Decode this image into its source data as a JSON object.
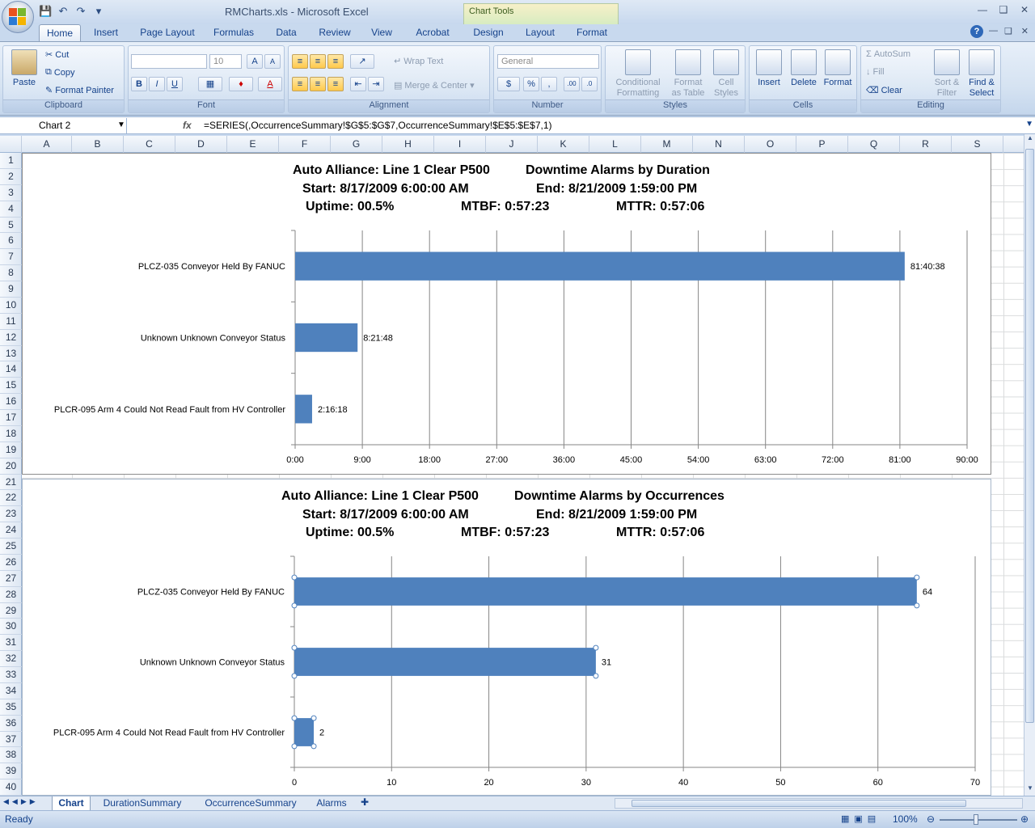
{
  "window": {
    "title": "RMCharts.xls - Microsoft Excel",
    "context_tab_group": "Chart Tools"
  },
  "ribbon_tabs": [
    "Home",
    "Insert",
    "Page Layout",
    "Formulas",
    "Data",
    "Review",
    "View",
    "Acrobat",
    "Design",
    "Layout",
    "Format"
  ],
  "active_tab": "Home",
  "ribbon": {
    "clipboard": {
      "label": "Clipboard",
      "paste": "Paste",
      "cut": "Cut",
      "copy": "Copy",
      "format_painter": "Format Painter"
    },
    "font": {
      "label": "Font",
      "size": "10",
      "bold": "B",
      "italic": "I",
      "underline": "U"
    },
    "alignment": {
      "label": "Alignment",
      "wrap": "Wrap Text",
      "merge": "Merge & Center"
    },
    "number": {
      "label": "Number",
      "format": "General",
      "currency": "$",
      "percent": "%",
      "comma": ","
    },
    "styles": {
      "label": "Styles",
      "cond_l1": "Conditional",
      "cond_l2": "Formatting",
      "fmt_l1": "Format",
      "fmt_l2": "as Table",
      "cell_l1": "Cell",
      "cell_l2": "Styles"
    },
    "cells": {
      "label": "Cells",
      "insert": "Insert",
      "delete": "Delete",
      "format": "Format"
    },
    "editing": {
      "label": "Editing",
      "autosum": "AutoSum",
      "fill": "Fill",
      "clear": "Clear",
      "sort_l1": "Sort &",
      "sort_l2": "Filter",
      "find_l1": "Find &",
      "find_l2": "Select"
    }
  },
  "formula_bar": {
    "name_box": "Chart 2",
    "fx": "fx",
    "formula": "=SERIES(,OccurrenceSummary!$G$5:$G$7,OccurrenceSummary!$E$5:$E$7,1)"
  },
  "columns": [
    "A",
    "B",
    "C",
    "D",
    "E",
    "F",
    "G",
    "H",
    "I",
    "J",
    "K",
    "L",
    "M",
    "N",
    "O",
    "P",
    "Q",
    "R",
    "S"
  ],
  "rows": [
    "1",
    "2",
    "3",
    "4",
    "5",
    "6",
    "7",
    "8",
    "9",
    "10",
    "11",
    "12",
    "13",
    "14",
    "15",
    "16",
    "17",
    "18",
    "19",
    "20",
    "21",
    "22",
    "23",
    "24",
    "25",
    "26",
    "27",
    "28",
    "29",
    "30",
    "31",
    "32",
    "33",
    "34",
    "35",
    "36",
    "37",
    "38",
    "39",
    "40"
  ],
  "sheet_tabs": [
    "Chart",
    "DurationSummary",
    "OccurrenceSummary",
    "Alarms"
  ],
  "active_sheet": "Chart",
  "status": {
    "ready": "Ready",
    "zoom": "100%"
  },
  "chart_data": [
    {
      "type": "bar",
      "title_lines": [
        [
          "Auto Alliance: Line 1 Clear P500",
          "Downtime Alarms by  Duration"
        ],
        [
          "Start: 8/17/2009 6:00:00 AM",
          "End: 8/21/2009 1:59:00 PM"
        ],
        [
          "Uptime: 00.5%",
          "MTBF: 0:57:23",
          "MTTR: 0:57:06"
        ]
      ],
      "categories": [
        "PLCZ-035 Conveyor Held By FANUC",
        "Unknown Unknown Conveyor Status",
        "PLCR-095 Arm 4 Could Not Read Fault from HV Controller"
      ],
      "values_hours": [
        81.6439,
        8.3633,
        2.2717
      ],
      "data_labels": [
        "81:40:38",
        "8:21:48",
        "2:16:18"
      ],
      "xlim": [
        0,
        90
      ],
      "tick_labels": [
        "0:00",
        "9:00",
        "18:00",
        "27:00",
        "36:00",
        "45:00",
        "54:00",
        "63:00",
        "72:00",
        "81:00",
        "90:00"
      ],
      "grid": true
    },
    {
      "type": "bar",
      "title_lines": [
        [
          "Auto Alliance: Line 1 Clear P500",
          "Downtime Alarms by  Occurrences"
        ],
        [
          "Start: 8/17/2009 6:00:00 AM",
          "End: 8/21/2009 1:59:00 PM"
        ],
        [
          "Uptime: 00.5%",
          "MTBF: 0:57:23",
          "MTTR: 0:57:06"
        ]
      ],
      "categories": [
        "PLCZ-035 Conveyor Held By FANUC",
        "Unknown Unknown Conveyor Status",
        "PLCR-095 Arm 4 Could Not Read Fault from HV Controller"
      ],
      "values": [
        64,
        31,
        2
      ],
      "data_labels": [
        "64",
        "31",
        "2"
      ],
      "xlim": [
        0,
        70
      ],
      "tick_labels": [
        "0",
        "10",
        "20",
        "30",
        "40",
        "50",
        "60",
        "70"
      ],
      "grid": true,
      "selected": true
    }
  ]
}
